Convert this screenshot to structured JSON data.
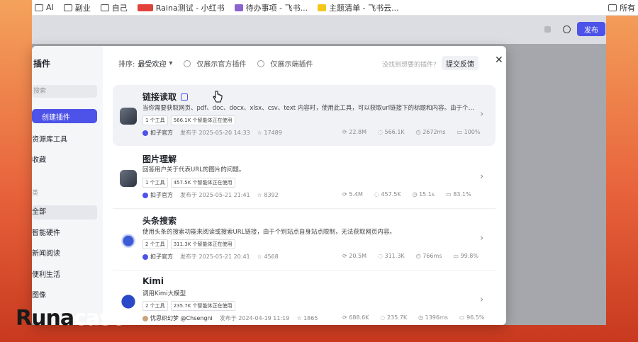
{
  "bookmarks": [
    {
      "label": "AI",
      "icon": "folder-icon"
    },
    {
      "label": "副业",
      "icon": "folder-icon"
    },
    {
      "label": "自己",
      "icon": "folder-icon"
    },
    {
      "label": "Raina测试 - 小红书",
      "icon": "xiaohongshu-icon"
    },
    {
      "label": "待办事项 - 飞书...",
      "icon": "doc-icon"
    },
    {
      "label": "主题清单 - 飞书云...",
      "icon": "note-icon"
    }
  ],
  "bookmarks_right": "所有",
  "app": {
    "publish_label": "发布"
  },
  "sidebar": {
    "title": "插件",
    "search_placeholder": "搜索",
    "create_label": "创建插件",
    "items": [
      "资源库工具",
      "收藏"
    ],
    "section_label": "类",
    "categories": [
      "全部",
      "智能硬件",
      "新闻阅读",
      "便利生活",
      "图像"
    ]
  },
  "toolbar": {
    "sort_label": "排序:",
    "sort_value": "最受欢迎",
    "filter_official": "仅展示官方插件",
    "filter_device": "仅展示端插件",
    "hint": "没找到想要的插件?",
    "feedback_label": "提交反馈",
    "close": "✕"
  },
  "plugins": [
    {
      "title": "链接读取",
      "desc": "当你需要获取网页、pdf、doc、docx、xlsx、csv、text 内容时，使用此工具，可以获取url链接下的标题和内容。由于个别网站自身站点...",
      "tags": [
        "1 个工具",
        "566.1K 个智能体正在使用"
      ],
      "author": "扣子官方",
      "published": "发布于 2025-05-20 14:33",
      "stars": "17489",
      "stats": [
        "22.8M",
        "566.1K",
        "2672ms",
        "100%"
      ]
    },
    {
      "title": "图片理解",
      "desc": "回答用户关于代表URL的图片的问题。",
      "tags": [
        "1 个工具",
        "457.5K 个智能体正在使用"
      ],
      "author": "扣子官方",
      "published": "发布于 2025-05-21 21:41",
      "stars": "8392",
      "stats": [
        "5.4M",
        "457.5K",
        "15.1s",
        "83.1%"
      ]
    },
    {
      "title": "头条搜索",
      "desc": "使用头条的搜索功能来阅读或搜索URL链接，由于个别站点自身站点限制，无法获取网页内容。",
      "tags": [
        "2 个工具",
        "311.3K 个智能体正在使用"
      ],
      "author": "扣子官方",
      "published": "发布于 2025-05-21 20:41",
      "stars": "4568",
      "stats": [
        "20.5M",
        "311.3K",
        "766ms",
        "99.8%"
      ]
    },
    {
      "title": "Kimi",
      "desc": "调用Kimi大模型",
      "tags": [
        "2 个工具",
        "235.7K 个智能体正在使用"
      ],
      "author": "忧思织幻梦 @Chsengni",
      "published": "发布于 2024-04-19 11:19",
      "stars": "1865",
      "stats": [
        "688.6K",
        "235.7K",
        "1396ms",
        "96.5%"
      ]
    }
  ],
  "watermark": {
    "dark": "Runa",
    "light": "case"
  }
}
